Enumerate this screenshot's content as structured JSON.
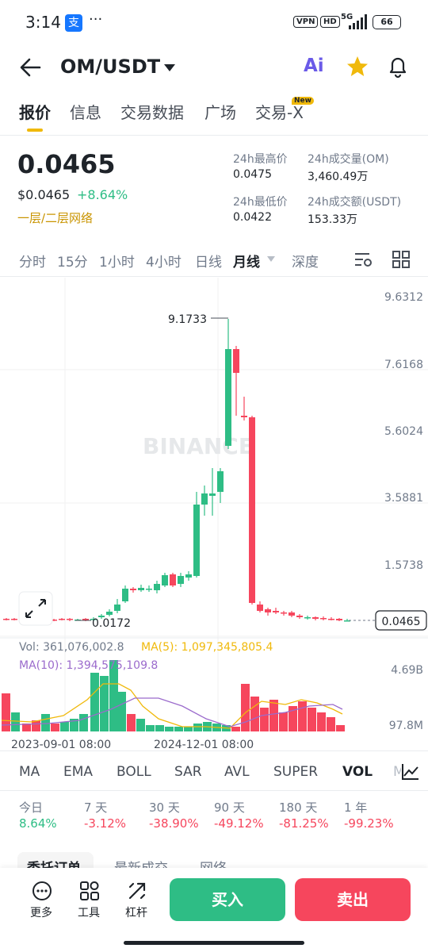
{
  "status_bar": {
    "time": "3:14",
    "app_icon": "支",
    "more": "···",
    "vpn": "VPN",
    "hd": "HD",
    "network": "5G",
    "battery": "66"
  },
  "header": {
    "pair": "OM/USDT",
    "ai_label": "Ai"
  },
  "tabs": [
    {
      "label": "报价",
      "active": true
    },
    {
      "label": "信息"
    },
    {
      "label": "交易数据"
    },
    {
      "label": "广场"
    },
    {
      "label": "交易-X",
      "badge": "New"
    }
  ],
  "price": {
    "last": "0.0465",
    "usd": "$0.0465",
    "change": "+8.64%",
    "network": "一层/二层网络",
    "stats": [
      {
        "label": "24h最高价",
        "value": "0.0475"
      },
      {
        "label": "24h成交量(OM)",
        "value": "3,460.49万"
      },
      {
        "label": "24h最低价",
        "value": "0.0422"
      },
      {
        "label": "24h成交额(USDT)",
        "value": "153.33万"
      }
    ]
  },
  "timeframes": [
    "分时",
    "15分",
    "1小时",
    "4小时",
    "日线",
    "月线",
    "深度"
  ],
  "active_timeframe": "月线",
  "chart": {
    "watermark": "BINANCE",
    "y_ticks": [
      "9.6312",
      "7.6168",
      "5.6024",
      "3.5881",
      "1.5738"
    ],
    "high_label": "9.1733",
    "low_label": "0.0172",
    "current_price": "0.0465",
    "vol_line": "Vol: 361,076,002.8",
    "ma5_line": "MA(5): 1,097,345,805.4",
    "ma10_line": "MA(10): 1,394,575,109.8",
    "vol_ticks": [
      "4.69B",
      "97.8M"
    ],
    "x_labels": [
      "2023-09-01 08:00",
      "2024-12-01 08:00"
    ],
    "colors": {
      "up": "#2ebd85",
      "down": "#f6465d",
      "ma5": "#f0b90b",
      "ma10": "#9b6bcc"
    }
  },
  "indicators": [
    "MA",
    "EMA",
    "BOLL",
    "SAR",
    "AVL",
    "SUPER",
    "VOL",
    "M"
  ],
  "active_indicator": "VOL",
  "performance": [
    {
      "label": "今日",
      "value": "8.64%",
      "dir": "up"
    },
    {
      "label": "7 天",
      "value": "-3.12%",
      "dir": "down"
    },
    {
      "label": "30 天",
      "value": "-38.90%",
      "dir": "down"
    },
    {
      "label": "90 天",
      "value": "-49.12%",
      "dir": "down"
    },
    {
      "label": "180 天",
      "value": "-81.25%",
      "dir": "down"
    },
    {
      "label": "1 年",
      "value": "-99.23%",
      "dir": "down"
    }
  ],
  "bottom_tabs": [
    "委托订单",
    "最新成交",
    "网络"
  ],
  "bottom_nav": {
    "more": "更多",
    "tools": "工具",
    "leverage": "杠杆",
    "buy": "买入",
    "sell": "卖出"
  }
}
